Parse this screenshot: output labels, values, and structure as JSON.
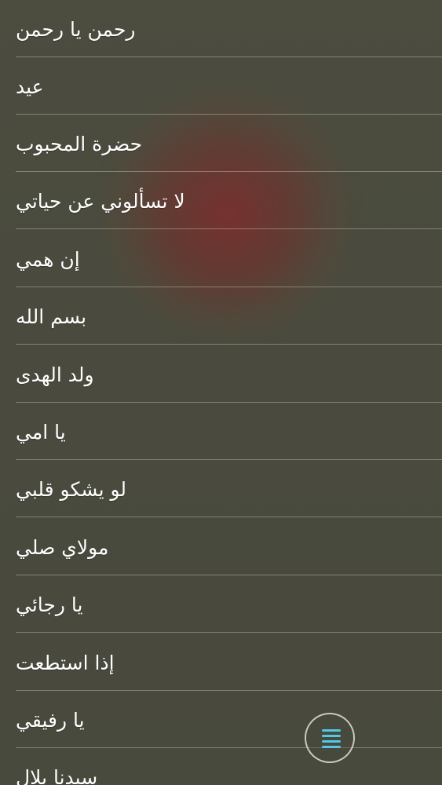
{
  "songs": [
    "رحمن يا رحمن",
    "عيد",
    "حضرة المحبوب",
    "لا تسألوني عن حياتي",
    "إن همي",
    "بسم الله",
    "ولد الهدى",
    "يا امي",
    "لو يشكو قلبي",
    "مولاي صلي",
    "يا رجائي",
    "إذا استطعت",
    "يا رفيقي",
    "سيدنا بلال"
  ],
  "menu_button": {
    "icon": "menu-icon",
    "color": "#52c7e8"
  }
}
